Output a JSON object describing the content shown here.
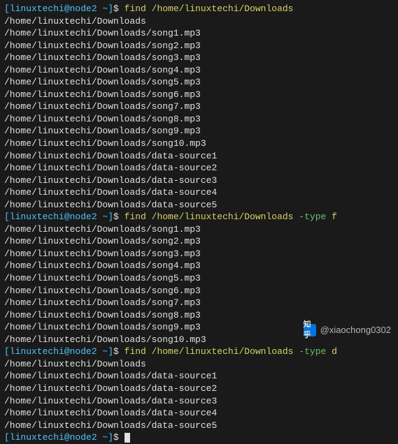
{
  "prompt": {
    "user": "linuxtechi",
    "host": "node2",
    "path": "~",
    "open": "[",
    "at": "@",
    "close": "]",
    "dollar": "$"
  },
  "commands": {
    "c1": {
      "bin": "find",
      "path": "/home/linuxtechi/Downloads"
    },
    "c2": {
      "bin": "find",
      "path": "/home/linuxtechi/Downloads",
      "flag": "-type",
      "flagval": "f"
    },
    "c3": {
      "bin": "find",
      "path": "/home/linuxtechi/Downloads",
      "flag": "-type",
      "flagval": "d"
    }
  },
  "out1": [
    "/home/linuxtechi/Downloads",
    "/home/linuxtechi/Downloads/song1.mp3",
    "/home/linuxtechi/Downloads/song2.mp3",
    "/home/linuxtechi/Downloads/song3.mp3",
    "/home/linuxtechi/Downloads/song4.mp3",
    "/home/linuxtechi/Downloads/song5.mp3",
    "/home/linuxtechi/Downloads/song6.mp3",
    "/home/linuxtechi/Downloads/song7.mp3",
    "/home/linuxtechi/Downloads/song8.mp3",
    "/home/linuxtechi/Downloads/song9.mp3",
    "/home/linuxtechi/Downloads/song10.mp3",
    "/home/linuxtechi/Downloads/data-source1",
    "/home/linuxtechi/Downloads/data-source2",
    "/home/linuxtechi/Downloads/data-source3",
    "/home/linuxtechi/Downloads/data-source4",
    "/home/linuxtechi/Downloads/data-source5"
  ],
  "out2": [
    "/home/linuxtechi/Downloads/song1.mp3",
    "/home/linuxtechi/Downloads/song2.mp3",
    "/home/linuxtechi/Downloads/song3.mp3",
    "/home/linuxtechi/Downloads/song4.mp3",
    "/home/linuxtechi/Downloads/song5.mp3",
    "/home/linuxtechi/Downloads/song6.mp3",
    "/home/linuxtechi/Downloads/song7.mp3",
    "/home/linuxtechi/Downloads/song8.mp3",
    "/home/linuxtechi/Downloads/song9.mp3",
    "/home/linuxtechi/Downloads/song10.mp3"
  ],
  "out3": [
    "/home/linuxtechi/Downloads",
    "/home/linuxtechi/Downloads/data-source1",
    "/home/linuxtechi/Downloads/data-source2",
    "/home/linuxtechi/Downloads/data-source3",
    "/home/linuxtechi/Downloads/data-source4",
    "/home/linuxtechi/Downloads/data-source5"
  ],
  "watermark": {
    "label": "知乎",
    "handle": "@xiaochong0302"
  }
}
